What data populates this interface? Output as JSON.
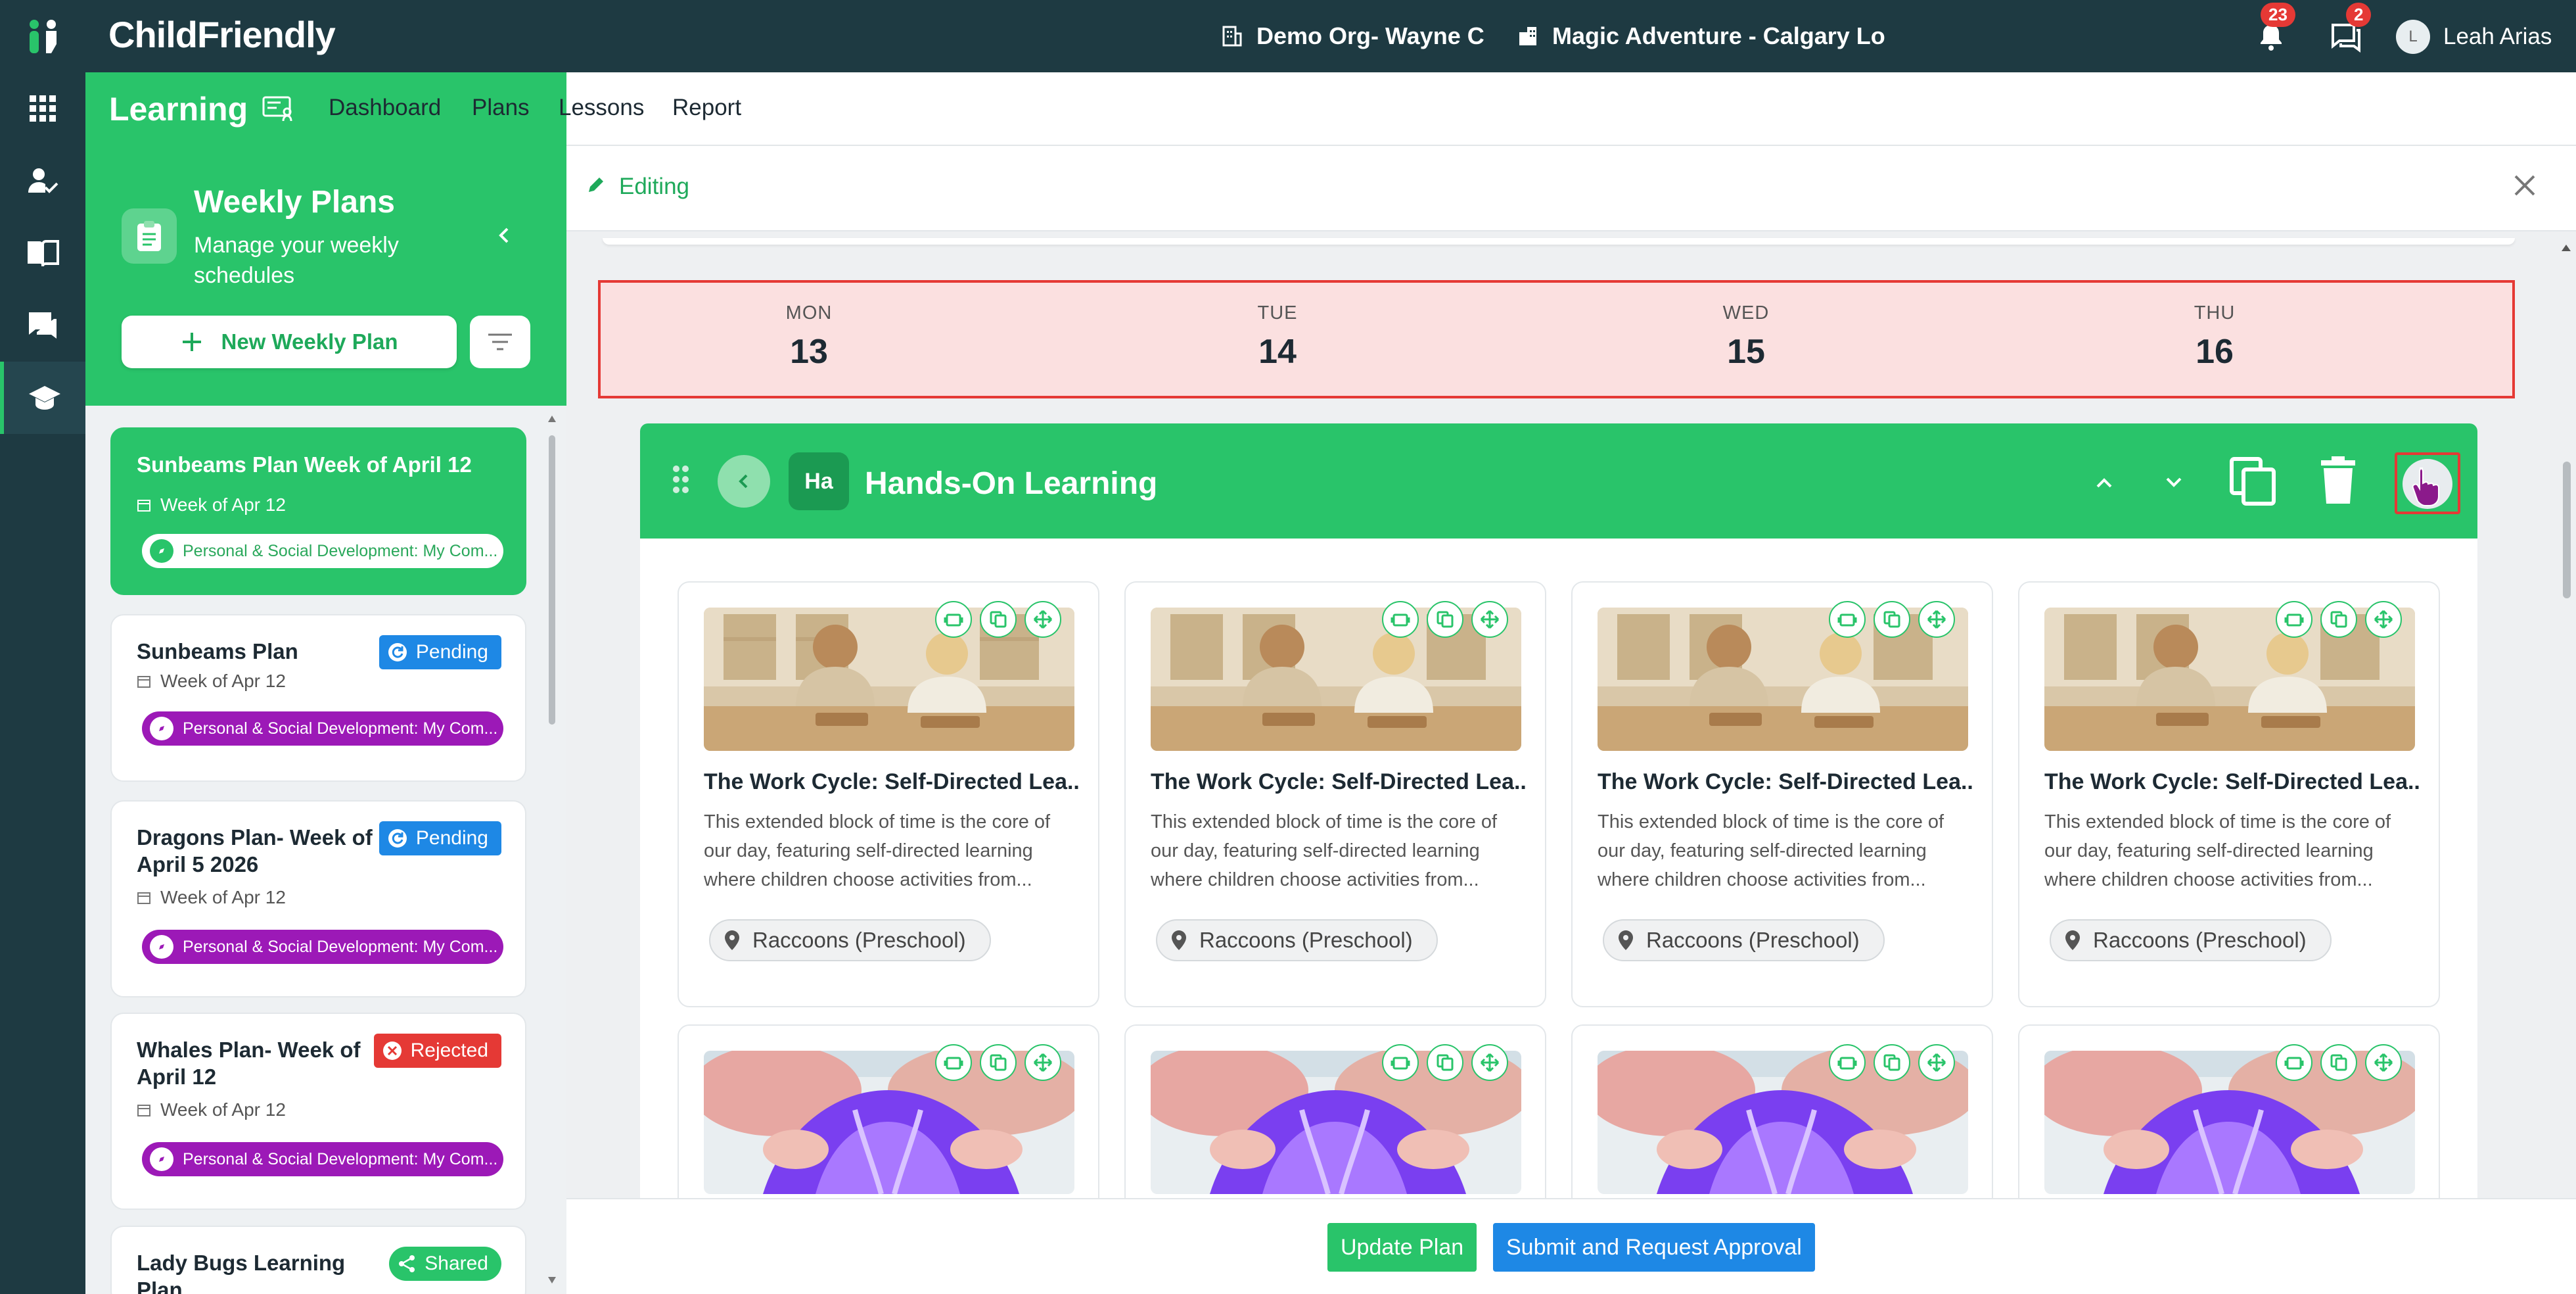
{
  "app": {
    "brand": "ChildFriendly",
    "org": "Demo Org- Wayne C",
    "location": "Magic Adventure - Calgary Lo",
    "notifications_count": "23",
    "messages_count": "2",
    "user_initial": "L",
    "user_name": "Leah Arias"
  },
  "module": {
    "title": "Learning",
    "tabs": [
      "Dashboard",
      "Plans",
      "Lessons",
      "Report"
    ],
    "active_tab": "Plans"
  },
  "sidebar": {
    "title": "Weekly Plans",
    "subtitle": "Manage your weekly schedules",
    "new_button": "New Weekly Plan",
    "plans": [
      {
        "title": "Sunbeams Plan Week of April 12",
        "week": "Week of Apr 12",
        "tag": "Personal & Social Development: My Com...",
        "status": ""
      },
      {
        "title": "Sunbeams Plan",
        "week": "Week of Apr 12",
        "tag": "Personal & Social Development: My Com...",
        "status": "Pending"
      },
      {
        "title": "Dragons Plan- Week of April 5 2026",
        "week": "Week of Apr 12",
        "tag": "Personal & Social Development: My Com...",
        "status": "Pending"
      },
      {
        "title": "Whales Plan- Week of April 12",
        "week": "Week of Apr 12",
        "tag": "Personal & Social Development: My Com...",
        "status": "Rejected"
      },
      {
        "title": "Lady Bugs Learning Plan",
        "week": "",
        "tag": "",
        "status": "Shared"
      }
    ]
  },
  "editor": {
    "mode_label": "Editing",
    "days": [
      {
        "name": "MON",
        "num": "13"
      },
      {
        "name": "TUE",
        "num": "14"
      },
      {
        "name": "WED",
        "num": "15"
      },
      {
        "name": "THU",
        "num": "16"
      }
    ],
    "section": {
      "abbr": "Ha",
      "title": "Hands-On Learning"
    },
    "cards": [
      {
        "title": "The Work Cycle: Self-Directed Lea...",
        "desc": "This extended block of time is the core of our day, featuring self-directed learning where children choose activities from...",
        "location": "Raccoons (Preschool)"
      },
      {
        "title": "The Work Cycle: Self-Directed Lea...",
        "desc": "This extended block of time is the core of our day, featuring self-directed learning where children choose activities from...",
        "location": "Raccoons (Preschool)"
      },
      {
        "title": "The Work Cycle: Self-Directed Lea...",
        "desc": "This extended block of time is the core of our day, featuring self-directed learning where children choose activities from...",
        "location": "Raccoons (Preschool)"
      },
      {
        "title": "The Work Cycle: Self-Directed Lea...",
        "desc": "This extended block of time is the core of our day, featuring self-directed learning where children choose activities from...",
        "location": "Raccoons (Preschool)"
      }
    ]
  },
  "footer": {
    "update_label": "Update Plan",
    "submit_label": "Submit and Request Approval"
  },
  "colors": {
    "brand_green": "#29c46a",
    "dark_teal": "#1e3a42",
    "pending_blue": "#1e88e5",
    "rejected_red": "#e53935",
    "tag_purple": "#9c19b7"
  }
}
